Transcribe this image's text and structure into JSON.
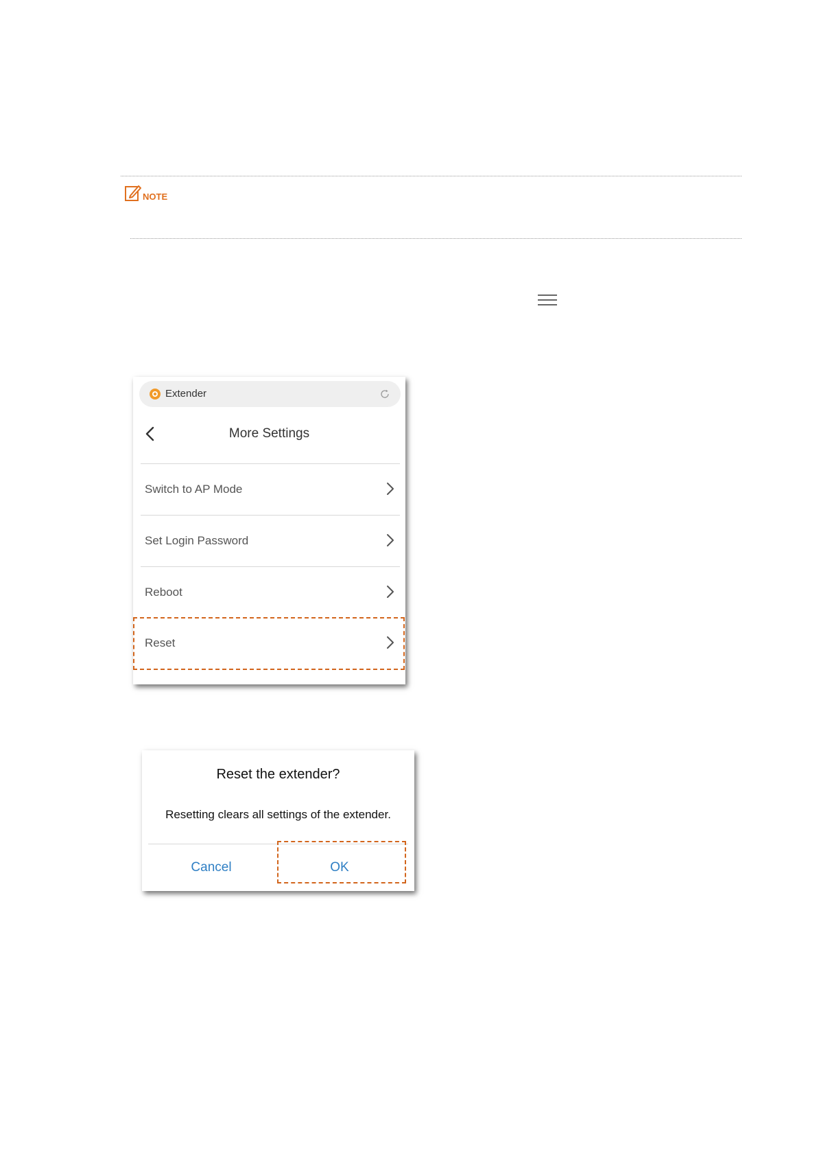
{
  "note": {
    "label": "NOTE"
  },
  "phone": {
    "address_bar": {
      "title": "Extender"
    },
    "header": {
      "title": "More Settings"
    },
    "items": [
      {
        "label": "Switch to AP Mode"
      },
      {
        "label": "Set Login Password"
      },
      {
        "label": "Reboot"
      },
      {
        "label": "Reset"
      }
    ]
  },
  "dialog": {
    "title": "Reset the extender?",
    "message": "Resetting clears all settings of the extender.",
    "cancel_label": "Cancel",
    "ok_label": "OK"
  },
  "colors": {
    "accent_orange": "#e0701f",
    "highlight_dash": "#d2651c",
    "button_blue": "#2f7fc4"
  }
}
